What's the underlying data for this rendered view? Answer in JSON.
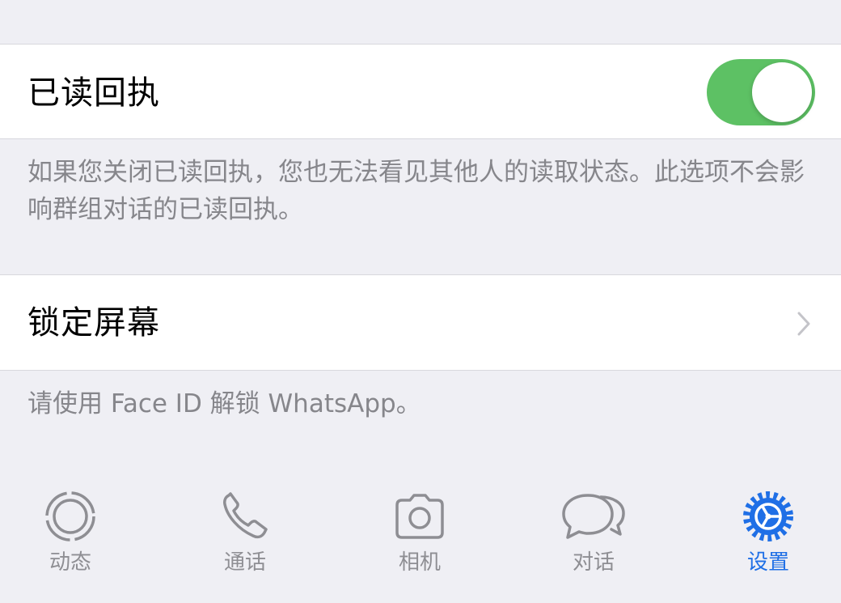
{
  "read_receipts": {
    "label": "已读回执",
    "enabled": true,
    "footnote": "如果您关闭已读回执，您也无法看见其他人的读取状态。此选项不会影响群组对话的已读回执。"
  },
  "screen_lock": {
    "label": "锁定屏幕",
    "footnote": "请使用 Face ID 解锁 WhatsApp。"
  },
  "tabbar": {
    "active": "settings",
    "tabs": [
      {
        "id": "status",
        "label": "动态",
        "icon": "status-icon"
      },
      {
        "id": "calls",
        "label": "通话",
        "icon": "phone-icon"
      },
      {
        "id": "camera",
        "label": "相机",
        "icon": "camera-icon"
      },
      {
        "id": "chats",
        "label": "对话",
        "icon": "chat-bubbles-icon"
      },
      {
        "id": "settings",
        "label": "设置",
        "icon": "gear-icon"
      }
    ]
  },
  "colors": {
    "background": "#efeff4",
    "toggle_on": "#5dc164",
    "active_tab": "#1f6fe6",
    "inactive_tab": "#8e8e93",
    "footnote_text": "#86868b"
  }
}
